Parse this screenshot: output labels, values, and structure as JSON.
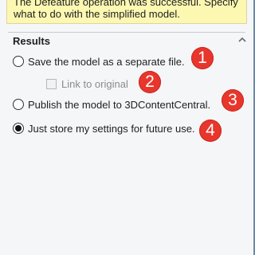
{
  "message": {
    "line1": "The Defeature operation was successful. Specify",
    "line2": "what to do with the simplified model."
  },
  "results": {
    "title": "Results",
    "options": [
      {
        "label": "Save the model as a separate file.",
        "checked": false
      },
      {
        "label": "Publish the model to 3DContentCentral.",
        "checked": false
      },
      {
        "label": "Just store my settings for future use.",
        "checked": true
      }
    ],
    "link_to_original": {
      "label": "Link to original",
      "checked": false,
      "enabled": false
    }
  },
  "callouts": [
    "1",
    "2",
    "3",
    "4"
  ],
  "icons": {
    "collapse": "chevron-up-icon"
  },
  "colors": {
    "message_bg": "#fcf8b2",
    "callout_red": "#e8362c",
    "panel_bg": "#f5f6f8"
  }
}
